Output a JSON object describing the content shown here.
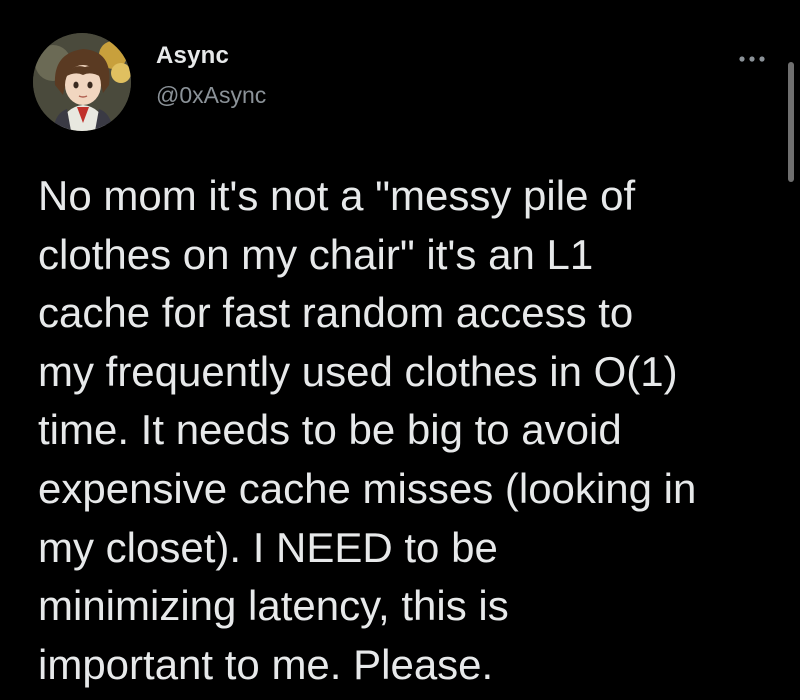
{
  "author": {
    "display_name": "Async",
    "handle": "@0xAsync",
    "avatar_icon": "anime-avatar"
  },
  "actions": {
    "more_icon": "more-dots-icon"
  },
  "tweet": {
    "lines": [
      "No mom it's not a \"messy pile of",
      "clothes on my chair\" it's an L1",
      "cache for fast random access to",
      "my frequently used clothes in O(1)",
      "time. It needs to be big to avoid",
      "expensive cache misses (looking in",
      "my closet). I NEED to be",
      "minimizing latency, this is",
      "important to me. Please."
    ]
  },
  "colors": {
    "background": "#000000",
    "text_primary": "#e7e9ea",
    "text_secondary": "#8b9298"
  }
}
